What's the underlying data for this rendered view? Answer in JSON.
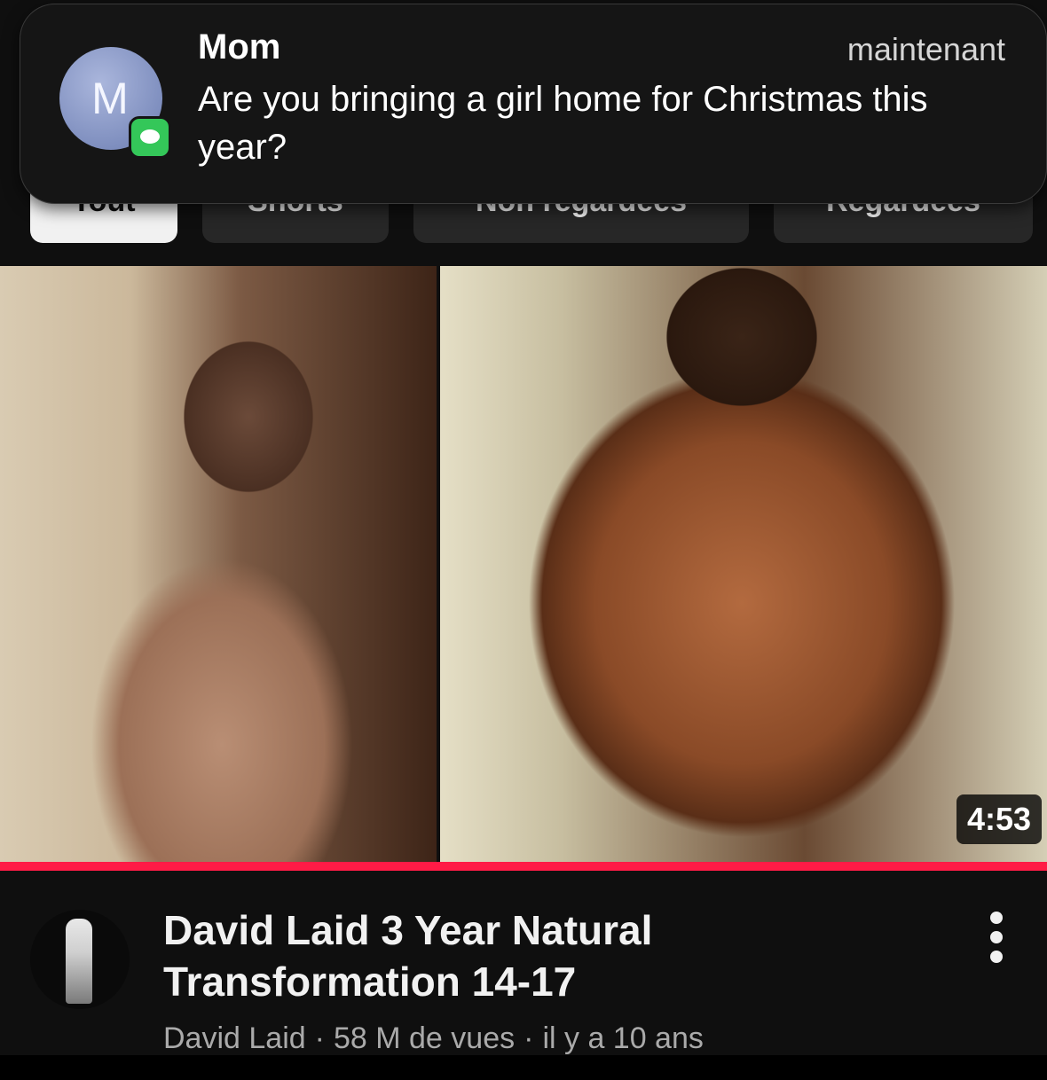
{
  "notification": {
    "avatar_letter": "M",
    "sender": "Mom",
    "time": "maintenant",
    "message": "Are you bringing a girl home for Christmas this year?",
    "app_icon": "messages-icon"
  },
  "chips": [
    {
      "label": "Tout",
      "active": true
    },
    {
      "label": "Shorts",
      "active": false
    },
    {
      "label": "Non regardées",
      "active": false
    },
    {
      "label": "Regardées",
      "active": false
    }
  ],
  "video": {
    "duration": "4:53",
    "watched_progress": 1.0,
    "title": "David Laid 3 Year Natural Transformation 14-17",
    "channel": "David Laid",
    "views": "58 M de vues",
    "age": "il y a 10 ans",
    "separator": "·",
    "progress_color": "#ff1b46"
  }
}
